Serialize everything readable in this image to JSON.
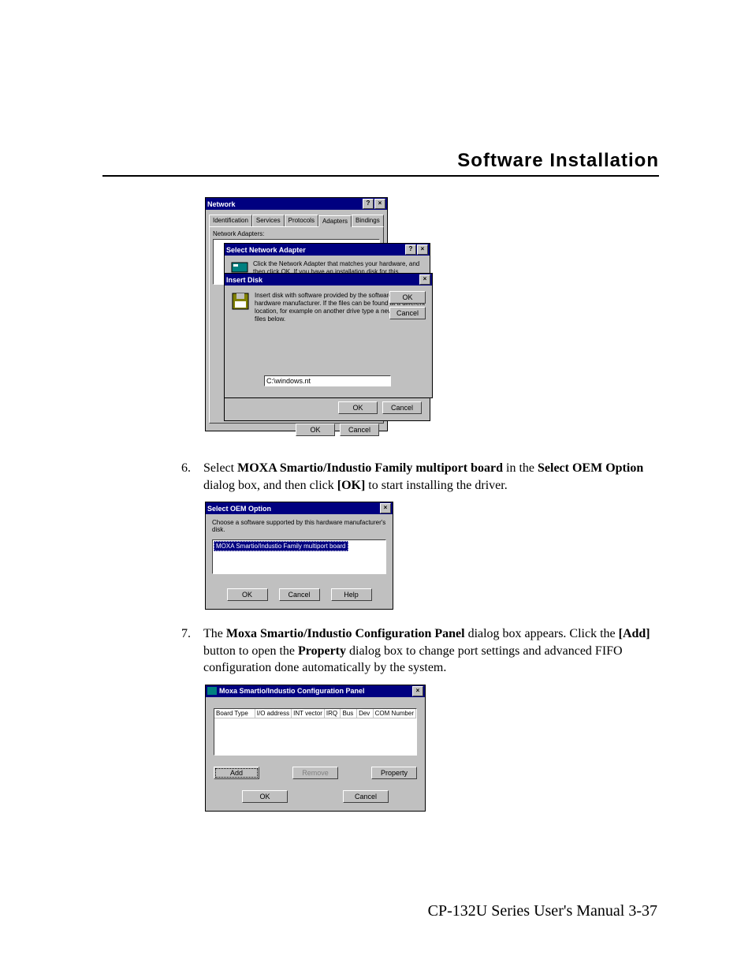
{
  "header": {
    "title": "Software Installation"
  },
  "footer": {
    "text": "CP-132U Series User's Manual 3-37"
  },
  "step6": {
    "num": "6.",
    "pre": "Select ",
    "bold1": "MOXA Smartio/Industio Family multiport board",
    "mid1": " in the ",
    "bold2": "Select OEM Option",
    "mid2": " dialog box, and then click ",
    "bold3": "[OK]",
    "post": " to start installing the driver."
  },
  "step7": {
    "num": "7.",
    "pre": "The ",
    "bold1": "Moxa Smartio/Industio Configuration Panel",
    "mid1": " dialog box appears. Click the ",
    "bold2": "[Add]",
    "mid2": " button to open the ",
    "bold3": "Property",
    "post": " dialog box to change port settings and advanced FIFO configuration done automatically by the system."
  },
  "network_window": {
    "title": "Network",
    "tabs": [
      "Identification",
      "Services",
      "Protocols",
      "Adapters",
      "Bindings"
    ],
    "section_label": "Network Adapters:",
    "ok": "OK",
    "cancel": "Cancel"
  },
  "select_adapter": {
    "title": "Select Network Adapter",
    "hint": "Click the Network Adapter that matches your hardware, and then click OK.  If you have an installation disk for this component, click",
    "ok": "OK",
    "cancel": "Cancel"
  },
  "insert_disk": {
    "title": "Insert Disk",
    "msg": "Insert disk with software provided by the software or hardware manufacturer. If the files can be found at a different location, for example on another drive type a new path to the files below.",
    "path": "C:\\windows.nt",
    "ok": "OK",
    "cancel": "Cancel"
  },
  "oem": {
    "title": "Select OEM Option",
    "label": "Choose a software supported by this hardware manufacturer's disk.",
    "item": "MOXA Smartio/Industio Family multiport board",
    "ok": "OK",
    "cancel": "Cancel",
    "help": "Help"
  },
  "cfg": {
    "title": "Moxa Smartio/Industio Configuration Panel",
    "cols": {
      "c1": "Board Type",
      "c2": "I/O address",
      "c3": "INT vector",
      "c4": "IRQ",
      "c5": "Bus",
      "c6": "Dev",
      "c7": "COM Number"
    },
    "add": "Add",
    "remove": "Remove",
    "property": "Property",
    "ok": "OK",
    "cancel": "Cancel"
  }
}
